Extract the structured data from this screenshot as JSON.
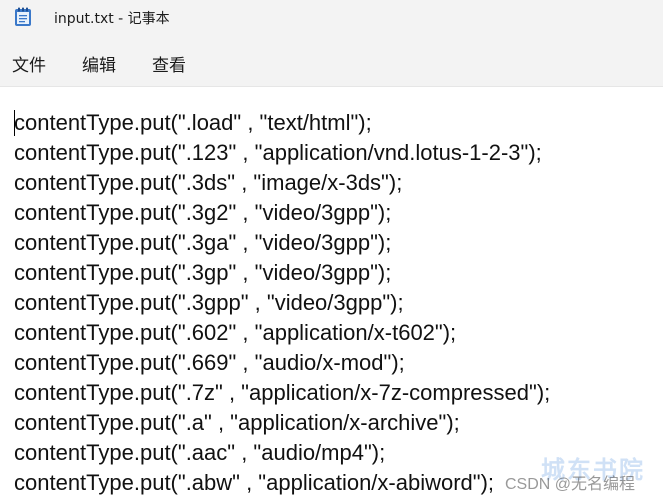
{
  "window": {
    "title": "input.txt - 记事本"
  },
  "menu": {
    "items": [
      "文件",
      "编辑",
      "查看"
    ]
  },
  "editor": {
    "lines": [
      "contentType.put(\".load\" , \"text/html\");",
      "contentType.put(\".123\" , \"application/vnd.lotus-1-2-3\");",
      "contentType.put(\".3ds\" , \"image/x-3ds\");",
      "contentType.put(\".3g2\" , \"video/3gpp\");",
      "contentType.put(\".3ga\" , \"video/3gpp\");",
      "contentType.put(\".3gp\" , \"video/3gpp\");",
      "contentType.put(\".3gpp\" , \"video/3gpp\");",
      "contentType.put(\".602\" , \"application/x-t602\");",
      "contentType.put(\".669\" , \"audio/x-mod\");",
      "contentType.put(\".7z\" , \"application/x-7z-compressed\");",
      "contentType.put(\".a\" , \"application/x-archive\");",
      "contentType.put(\".aac\" , \"audio/mp4\");",
      "contentType.put(\".abw\" , \"application/x-abiword\");"
    ]
  },
  "watermark": {
    "csdn": "CSDN @无名编程",
    "logo": "城东书院"
  },
  "icons": {
    "app": "notepad-icon"
  }
}
